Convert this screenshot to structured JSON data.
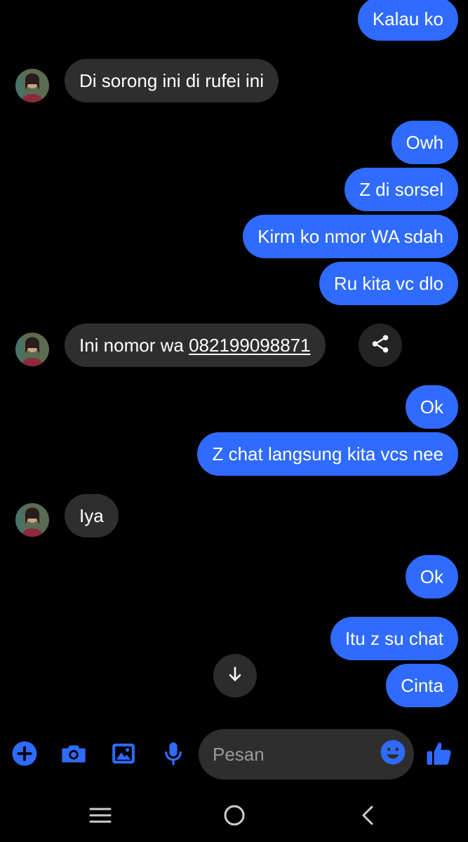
{
  "colors": {
    "accent": "#2f6bff",
    "incoming_bubble": "#2e2e2e",
    "background": "#000000"
  },
  "messages": [
    {
      "direction": "out",
      "text": "Kalau ko"
    },
    {
      "direction": "in",
      "text": "Di sorong ini di rufei ini"
    },
    {
      "direction": "out",
      "text": "Owh"
    },
    {
      "direction": "out",
      "text": "Z di sorsel"
    },
    {
      "direction": "out",
      "text": "Kirm ko nmor WA sdah"
    },
    {
      "direction": "out",
      "text": "Ru kita vc dlo"
    },
    {
      "direction": "in",
      "text": "Ini nomor wa ",
      "link": "082199098871"
    },
    {
      "direction": "out",
      "text": "Ok"
    },
    {
      "direction": "out",
      "text": "Z chat langsung kita vcs nee"
    },
    {
      "direction": "in",
      "text": "Iya"
    },
    {
      "direction": "out",
      "text": "Ok"
    },
    {
      "direction": "out",
      "text": "Itu z su chat"
    },
    {
      "direction": "out",
      "text": "Cinta"
    }
  ],
  "composer": {
    "placeholder": "Pesan",
    "icons": [
      "add-icon",
      "camera-icon",
      "gallery-icon",
      "microphone-icon",
      "emoji-icon",
      "thumbs-up-icon"
    ]
  },
  "navigation": {
    "icons": [
      "recent-apps-icon",
      "home-icon",
      "back-icon"
    ]
  }
}
